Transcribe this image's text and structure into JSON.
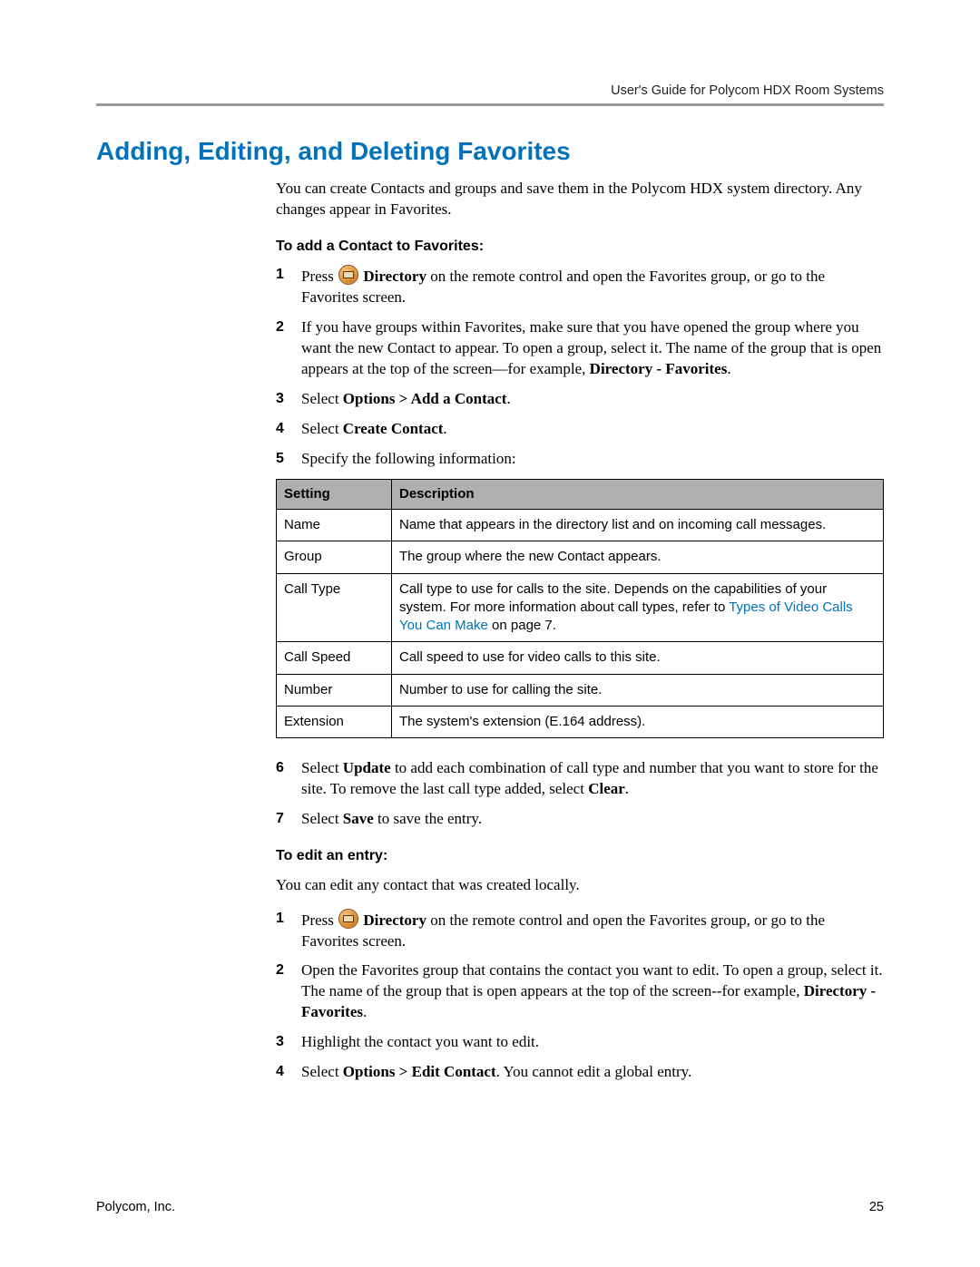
{
  "header": {
    "running_head": "User's Guide for Polycom HDX Room Systems"
  },
  "title": "Adding, Editing, and Deleting Favorites",
  "intro": "You can create Contacts and groups and save them in the Polycom HDX system directory. Any changes appear in Favorites.",
  "add": {
    "heading": "To add a Contact to Favorites:",
    "steps": {
      "s1_a": "Press ",
      "s1_b": " Directory",
      "s1_c": " on the remote control and open the Favorites group, or go to the Favorites screen.",
      "s2_a": "If you have groups within Favorites, make sure that you have opened the group where you want the new Contact to appear. To open a group, select it. The name of the group that is open appears at the top of the screen—for example, ",
      "s2_b": "Directory - Favorites",
      "s2_c": ".",
      "s3_a": "Select ",
      "s3_b": "Options > Add a Contact",
      "s3_c": ".",
      "s4_a": "Select ",
      "s4_b": "Create Contact",
      "s4_c": ".",
      "s5": "Specify the following information:",
      "s6_a": "Select ",
      "s6_b": "Update",
      "s6_c": " to add each combination of call type and number that you want to store for the site. To remove the last call type added, select ",
      "s6_d": "Clear",
      "s6_e": ".",
      "s7_a": "Select ",
      "s7_b": "Save",
      "s7_c": " to save the entry."
    }
  },
  "table": {
    "h1": "Setting",
    "h2": "Description",
    "rows": [
      {
        "setting": "Name",
        "desc": "Name that appears in the directory list and on incoming call messages."
      },
      {
        "setting": "Group",
        "desc": "The group where the new Contact appears."
      },
      {
        "setting": "Call Type",
        "desc_a": "Call type to use for calls to the site. Depends on the capabilities of your system. For more information about call types, refer to ",
        "link": "Types of Video Calls You Can Make",
        "desc_b": " on page 7."
      },
      {
        "setting": "Call Speed",
        "desc": "Call speed to use for video calls to this site."
      },
      {
        "setting": "Number",
        "desc": "Number to use for calling the site."
      },
      {
        "setting": "Extension",
        "desc": "The system's extension (E.164 address)."
      }
    ]
  },
  "edit": {
    "heading": "To edit an entry:",
    "intro": "You can edit any contact that was created locally.",
    "steps": {
      "s1_a": "Press ",
      "s1_b": " Directory",
      "s1_c": " on the remote control and open the Favorites group, or go to the Favorites screen.",
      "s2_a": "Open the Favorites group that contains the contact you want to edit. To open a group, select it. The name of the group that is open appears at the top of the screen--for example, ",
      "s2_b": "Directory - Favorites",
      "s2_c": ".",
      "s3": "Highlight the contact you want to edit.",
      "s4_a": "Select ",
      "s4_b": "Options > Edit Contact",
      "s4_c": ". You cannot edit a global entry."
    }
  },
  "footer": {
    "left": "Polycom, Inc.",
    "right": "25"
  }
}
